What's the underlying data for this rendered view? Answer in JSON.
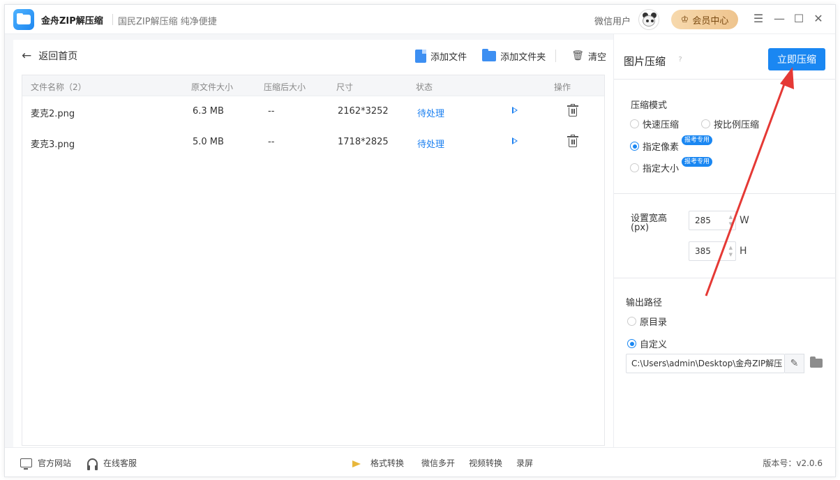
{
  "app": {
    "title": "金舟ZIP解压缩",
    "slogan": "国民ZIP解压缩  纯净便捷",
    "user_name": "微信用户",
    "vip_label": "会员中心",
    "window_controls": [
      "menu-icon",
      "minimize-icon",
      "maximize-icon",
      "close-icon"
    ]
  },
  "nav": {
    "back_label": "返回首页"
  },
  "toolbar": {
    "add_file": "添加文件",
    "add_folder": "添加文件夹",
    "clear": "清空"
  },
  "table": {
    "headers": {
      "name": "文件名称（2）",
      "orig_size": "原文件大小",
      "comp_size": "压缩后大小",
      "dimensions": "尺寸",
      "status": "状态",
      "actions": "操作"
    },
    "rows": [
      {
        "name": "麦克2.png",
        "orig_size": "6.3 MB",
        "comp_size": "--",
        "dimensions": "2162*3252",
        "status": "待处理"
      },
      {
        "name": "麦克3.png",
        "orig_size": "5.0 MB",
        "comp_size": "--",
        "dimensions": "1718*2825",
        "status": "待处理"
      }
    ]
  },
  "panel": {
    "title": "图片压缩",
    "help": "?",
    "compress_button": "立即压缩",
    "mode": {
      "label": "压缩模式",
      "options": [
        "快速压缩",
        "按比例压缩",
        "指定像素",
        "指定大小"
      ],
      "selected": "指定像素",
      "badge": "报考专用"
    },
    "size": {
      "label": "设置宽高",
      "unit": "(px)",
      "width": "285",
      "height": "385",
      "width_unit": "W",
      "height_unit": "H"
    },
    "output": {
      "label": "输出路径",
      "options": [
        "原目录",
        "自定义"
      ],
      "selected": "自定义",
      "path": "C:\\Users\\admin\\Desktop\\金舟ZIP解压"
    }
  },
  "footer": {
    "website": "官方网站",
    "support": "在线客服",
    "links": [
      "格式转换",
      "微信多开",
      "视频转换",
      "录屏"
    ],
    "version": "版本号：v2.0.6"
  },
  "colors": {
    "accent": "#1a87f2",
    "vip_gold": "#eec48e",
    "annotation_red": "#e53935"
  }
}
